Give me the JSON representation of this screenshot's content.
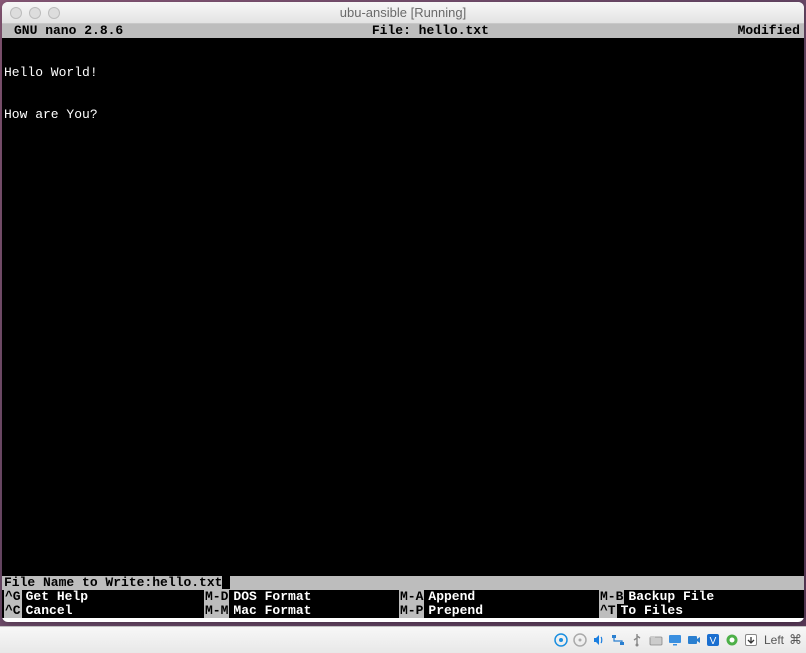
{
  "window": {
    "title": "ubu-ansible [Running]"
  },
  "nano": {
    "header": {
      "left": "GNU nano 2.8.6",
      "center": "File: hello.txt",
      "right": "Modified"
    },
    "content": {
      "line1": "Hello World!",
      "line2": "How are You?"
    },
    "prompt": {
      "label": "File Name to Write: ",
      "value": "hello.txt"
    },
    "shortcuts": {
      "row1": {
        "a": {
          "key": "^G",
          "label": "Get Help"
        },
        "b": {
          "key": "M-D",
          "label": "DOS Format"
        },
        "c": {
          "key": "M-A",
          "label": "Append"
        },
        "d": {
          "key": "M-B",
          "label": "Backup File"
        }
      },
      "row2": {
        "a": {
          "key": "^C",
          "label": "Cancel"
        },
        "b": {
          "key": "M-M",
          "label": "Mac Format"
        },
        "c": {
          "key": "M-P",
          "label": "Prepend"
        },
        "d": {
          "key": "^T",
          "label": "To Files"
        }
      }
    }
  },
  "statusbar": {
    "host_key": "Left",
    "cmd_symbol": "⌘"
  }
}
